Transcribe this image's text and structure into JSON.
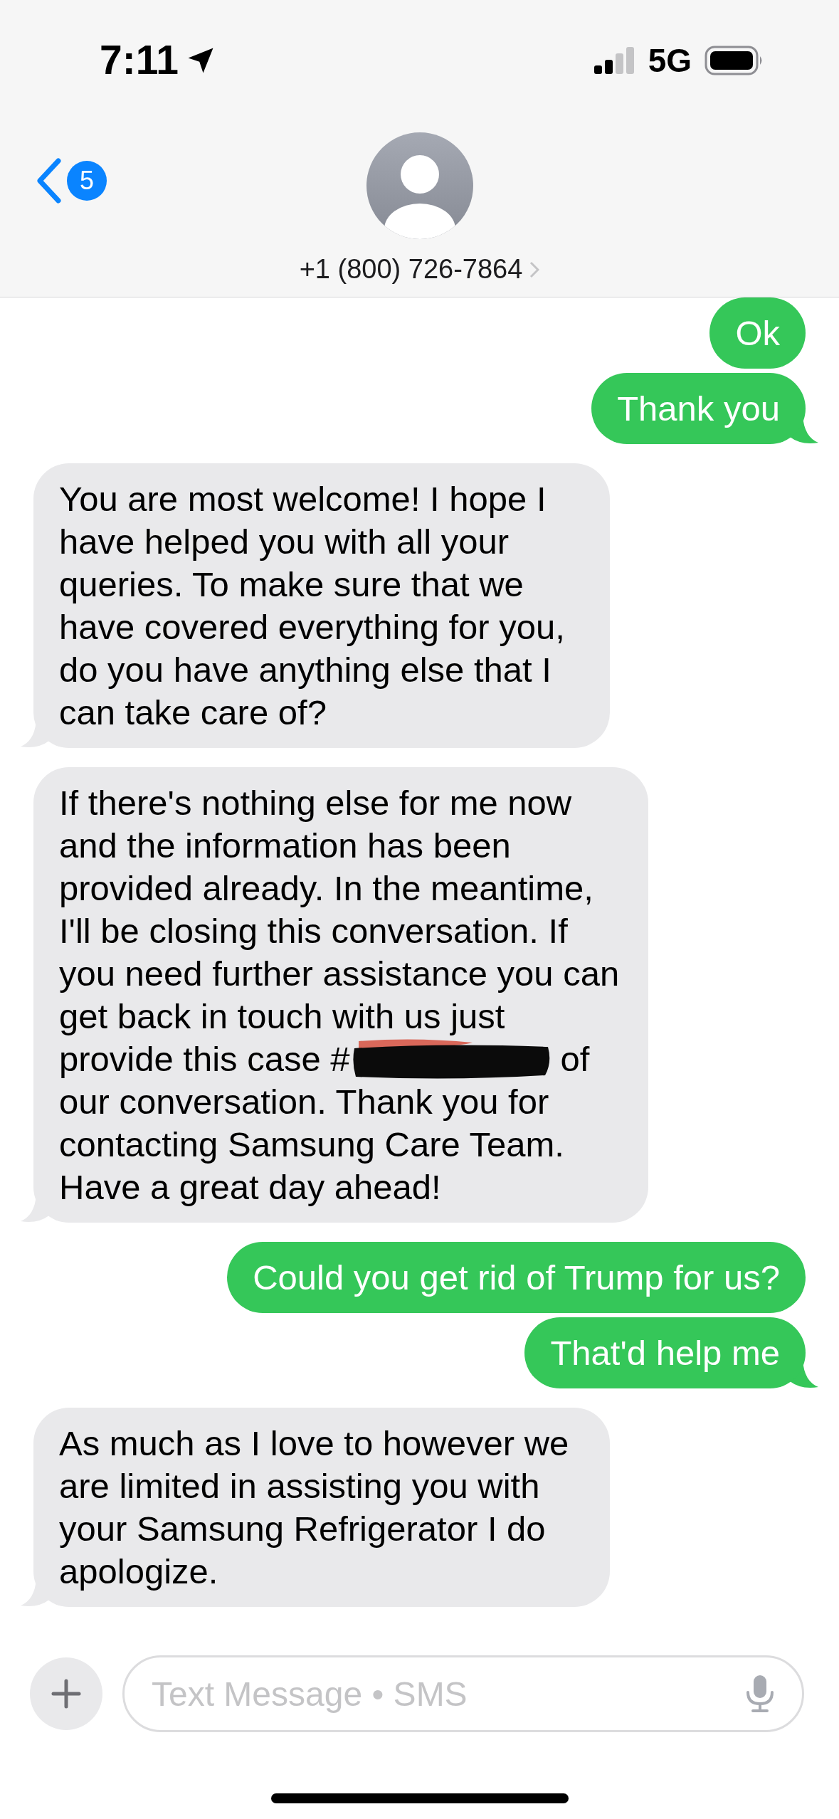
{
  "status_bar": {
    "time": "7:11",
    "network": "5G"
  },
  "header": {
    "back_badge": "5",
    "contact": "+1 (800) 726-7864"
  },
  "messages": [
    {
      "kind": "sent",
      "text": "Ok",
      "tail": false
    },
    {
      "kind": "sent",
      "text": "Thank you",
      "tail": true
    },
    {
      "kind": "received",
      "text": "You are most welcome! I hope I have helped you with all your queries. To make sure that we have covered everything for you, do you have anything else that I can take care of?",
      "tail": true
    },
    {
      "kind": "received",
      "text": "If there's nothing else for me now and the information has been provided already. In the meantime, I'll be closing this conversation. If you need further assistance you can get back in touch with us just",
      "redacted_line": {
        "before": "provide this case #",
        "after": "of"
      },
      "text_after": "our conversation. Thank you for contacting Samsung Care Team. Have a great day ahead!",
      "tail": true
    },
    {
      "kind": "sent",
      "text": "Could you get rid of Trump for us?",
      "tail": false
    },
    {
      "kind": "sent",
      "text": "That'd help me",
      "tail": true
    },
    {
      "kind": "received",
      "text": "As much as I love to however we are limited in assisting you with your Samsung Refrigerator I do apologize.",
      "tail": true
    }
  ],
  "composer": {
    "placeholder": "Text Message • SMS"
  }
}
